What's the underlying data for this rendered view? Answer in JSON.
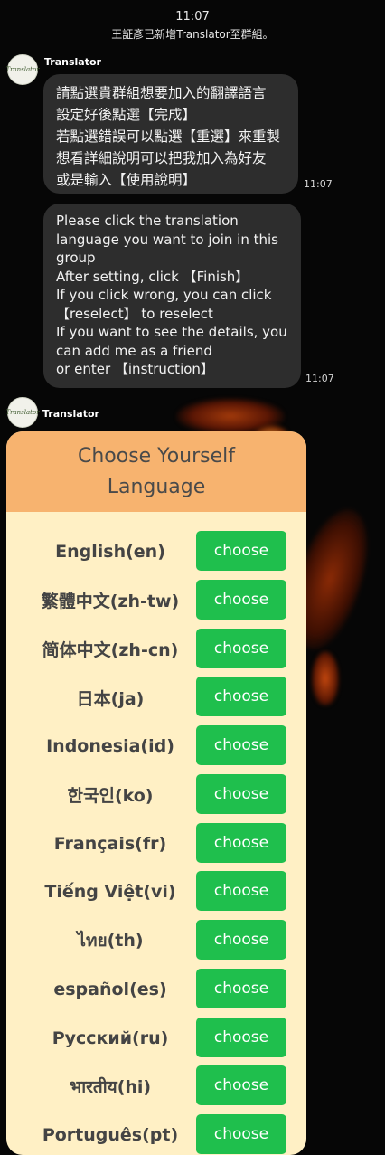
{
  "status_time": "11:07",
  "system_message": "王証彥已新增Translator至群組。",
  "messages": [
    {
      "sender": "Translator",
      "avatar_text": "Translator",
      "lines": [
        "請點選貴群組想要加入的翻譯語言",
        "設定好後點選【完成】",
        "若點選錯誤可以點選【重選】來重製",
        "想看詳細說明可以把我加入為好友",
        "或是輸入【使用說明】"
      ],
      "time": "11:07"
    },
    {
      "lines": [
        "Please click the translation",
        "language you want to join in this",
        "group",
        "After setting, click 【Finish】",
        "If you click wrong, you can click",
        "【reselect】 to reselect",
        "If you want to see the details, you",
        "can add me as a friend",
        "or enter 【instruction】"
      ],
      "time": "11:07"
    }
  ],
  "flex_message": {
    "sender": "Translator",
    "avatar_text": "Translator",
    "title_lines": [
      "Choose Yourself",
      "Language"
    ],
    "button_label": "choose",
    "languages": [
      "English(en)",
      "繁體中文(zh-tw)",
      "简体中文(zh-cn)",
      "日本(ja)",
      "Indonesia(id)",
      "한국인(ko)",
      "Français(fr)",
      "Tiếng Việt(vi)",
      "ไทย(th)",
      "español(es)",
      "Русский(ru)",
      "भारतीय(hi)",
      "Português(pt)"
    ]
  },
  "colors": {
    "bubble": "#2d2d2d",
    "card_header": "#f7b36f",
    "card_body": "#fff0c5",
    "choose_button": "#1fbf4d"
  }
}
